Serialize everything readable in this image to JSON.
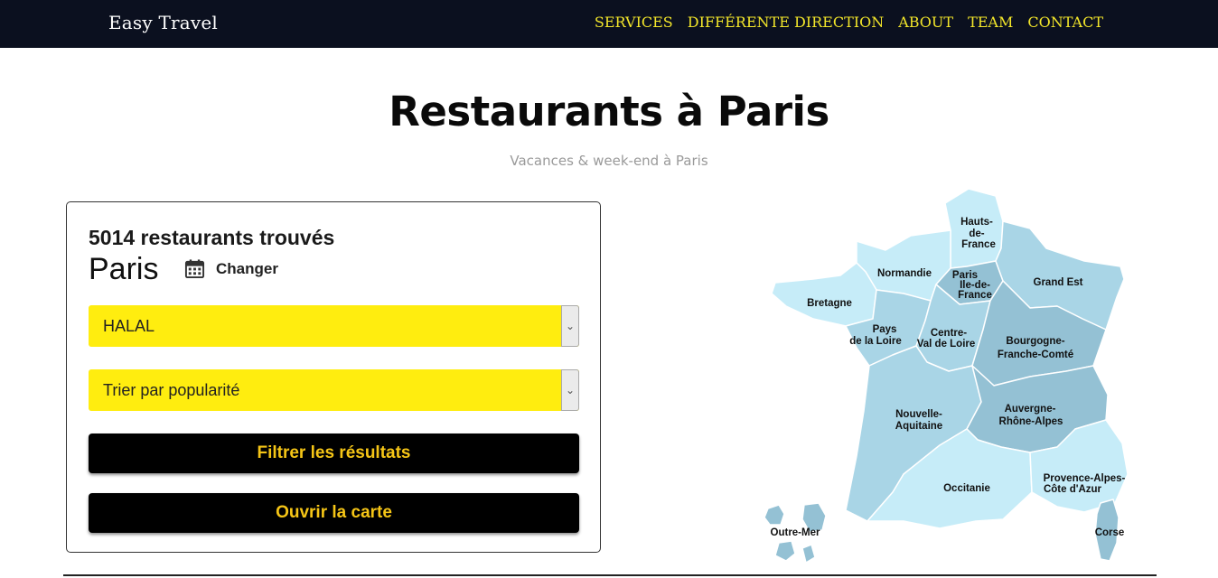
{
  "nav": {
    "brand": "Easy Travel",
    "links": [
      "SERVICES",
      "DIFFÉRENTE DIRECTION",
      "ABOUT",
      "TEAM",
      "CONTACT"
    ]
  },
  "hero": {
    "title": "Restaurants à Paris",
    "subtitle": "Vacances & week-end à Paris"
  },
  "search": {
    "count": "5014 restaurants trouvés",
    "city": "Paris",
    "change_label": "Changer",
    "filter_select": "HALAL",
    "sort_select": "Trier par popularité",
    "filter_button": "Filtrer les résultats",
    "map_button": "Ouvrir la carte"
  },
  "map": {
    "regions": {
      "hauts_de_france": [
        "Hauts-",
        "de-",
        "France"
      ],
      "normandie": "Normandie",
      "ile_de_france": [
        "Paris",
        "Ile-de-",
        "France"
      ],
      "grand_est": "Grand Est",
      "bretagne": "Bretagne",
      "pays_de_la_loire": [
        "Pays",
        "de la Loire"
      ],
      "centre_val_de_loire": [
        "Centre-",
        "Val de Loire"
      ],
      "bourgogne": [
        "Bourgogne-",
        "Franche-Comté"
      ],
      "nouvelle_aquitaine": [
        "Nouvelle-",
        "Aquitaine"
      ],
      "auvergne": [
        "Auvergne-",
        "Rhône-Alpes"
      ],
      "occitanie": "Occitanie",
      "paca": [
        "Provence-Alpes-",
        "Côte d'Azur"
      ],
      "outre_mer": "Outre-Mer",
      "corse": "Corse"
    },
    "colors": {
      "light": "#c6ecf8",
      "mid": "#a9d5e6",
      "dark": "#94c1d4",
      "stroke": "#ffffff"
    }
  }
}
